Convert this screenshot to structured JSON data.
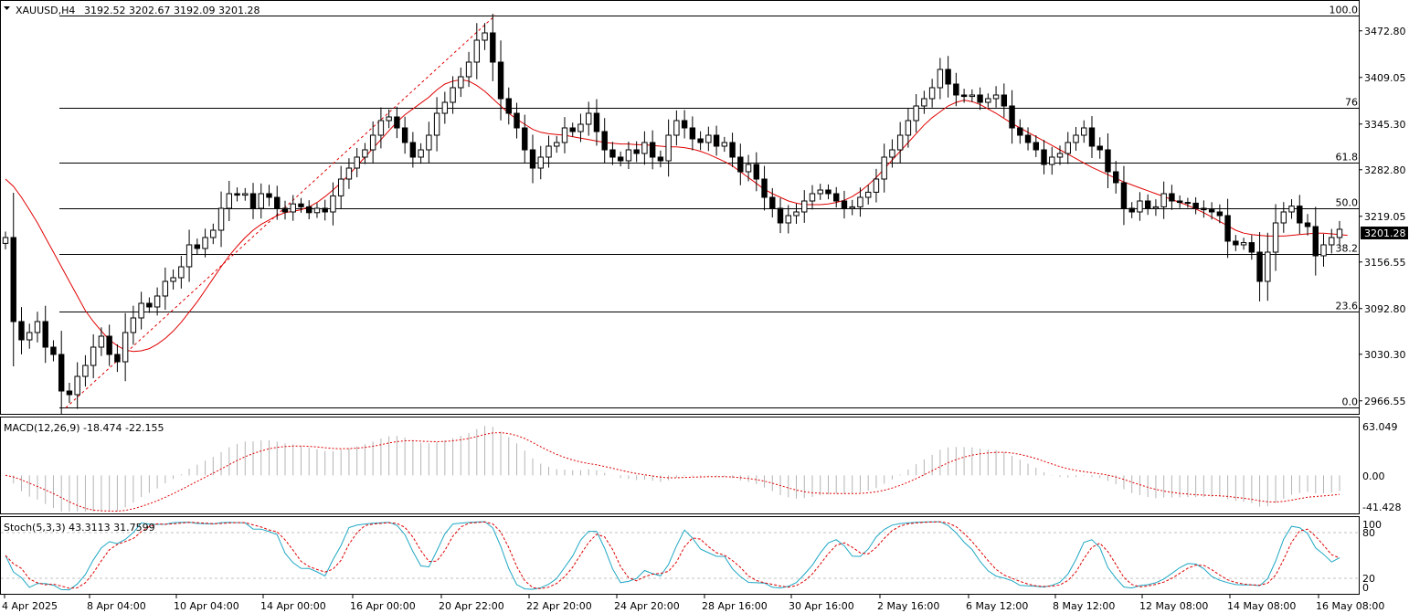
{
  "header": {
    "symbol": "XAUUSD,H4",
    "ohlc": "3192.52 3202.67 3192.09 3201.28"
  },
  "price_axis": {
    "ticks": [
      "3472.80",
      "3409.05",
      "3345.30",
      "3282.80",
      "3219.05",
      "3156.55",
      "3092.80",
      "3030.30",
      "2966.55"
    ],
    "current_price": "3201.28"
  },
  "fib_levels": [
    {
      "label": "100.0",
      "value": 3494
    },
    {
      "label": "76",
      "value": 3368
    },
    {
      "label": "61.8",
      "value": 3292
    },
    {
      "label": "50.0",
      "value": 3230
    },
    {
      "label": "38.2",
      "value": 3167
    },
    {
      "label": "23.6",
      "value": 3089
    },
    {
      "label": "0.0",
      "value": 2957
    }
  ],
  "time_axis": [
    "4 Apr 2025",
    "8 Apr 04:00",
    "10 Apr 04:00",
    "14 Apr 00:00",
    "16 Apr 00:00",
    "20 Apr 22:00",
    "22 Apr 20:00",
    "24 Apr 20:00",
    "28 Apr 16:00",
    "30 Apr 16:00",
    "2 May 16:00",
    "6 May 12:00",
    "8 May 12:00",
    "12 May 08:00",
    "14 May 08:00",
    "16 May 08:00"
  ],
  "macd": {
    "title": "MACD(12,26,9) -18.474 -22.155",
    "ticks": [
      "63.049",
      "0.00",
      "-41.428"
    ]
  },
  "stoch": {
    "title": "Stoch(5,3,3) 43.3113 31.7599",
    "ticks": [
      "100",
      "80",
      "20",
      "0"
    ]
  },
  "colors": {
    "bull": "#ffffff",
    "bear": "#000000",
    "ma": "#e00000",
    "signal": "#e00000",
    "stoch_main": "#1ea7c4",
    "hist": "#b4b4b4",
    "fib": "#000000",
    "current_bg": "#000000"
  },
  "chart_data": {
    "type": "candlestick",
    "closes": [
      3190,
      3075,
      3050,
      3060,
      3075,
      3040,
      3030,
      2980,
      2975,
      3000,
      3015,
      3040,
      3055,
      3030,
      3020,
      3060,
      3080,
      3100,
      3095,
      3110,
      3130,
      3135,
      3150,
      3180,
      3175,
      3190,
      3200,
      3230,
      3250,
      3248,
      3250,
      3230,
      3250,
      3245,
      3230,
      3225,
      3236,
      3232,
      3224,
      3230,
      3225,
      3247,
      3270,
      3285,
      3300,
      3310,
      3330,
      3350,
      3355,
      3340,
      3320,
      3300,
      3310,
      3330,
      3360,
      3375,
      3395,
      3410,
      3430,
      3460,
      3470,
      3430,
      3380,
      3360,
      3340,
      3310,
      3285,
      3300,
      3315,
      3320,
      3340,
      3335,
      3345,
      3360,
      3335,
      3310,
      3300,
      3295,
      3310,
      3305,
      3320,
      3300,
      3295,
      3330,
      3350,
      3340,
      3325,
      3320,
      3330,
      3315,
      3320,
      3300,
      3280,
      3290,
      3270,
      3245,
      3230,
      3210,
      3220,
      3225,
      3240,
      3250,
      3255,
      3250,
      3240,
      3230,
      3232,
      3245,
      3252,
      3270,
      3300,
      3310,
      3330,
      3350,
      3370,
      3380,
      3395,
      3420,
      3400,
      3385,
      3383,
      3385,
      3375,
      3380,
      3385,
      3370,
      3340,
      3330,
      3320,
      3310,
      3290,
      3300,
      3305,
      3320,
      3330,
      3340,
      3315,
      3310,
      3280,
      3265,
      3230,
      3225,
      3240,
      3230,
      3232,
      3250,
      3240,
      3238,
      3237,
      3230,
      3228,
      3225,
      3220,
      3185,
      3180,
      3183,
      3170,
      3130,
      3170,
      3210,
      3225,
      3233,
      3210,
      3205,
      3165,
      3180,
      3190,
      3201.28
    ],
    "ma20": [
      3270,
      3260,
      3245,
      3228,
      3210,
      3190,
      3170,
      3150,
      3130,
      3110,
      3090,
      3075,
      3062,
      3050,
      3042,
      3036,
      3034,
      3035,
      3038,
      3044,
      3052,
      3062,
      3074,
      3088,
      3102,
      3118,
      3134,
      3150,
      3165,
      3178,
      3190,
      3200,
      3208,
      3214,
      3220,
      3224,
      3226,
      3228,
      3232,
      3238,
      3246,
      3255,
      3265,
      3276,
      3288,
      3300,
      3312,
      3324,
      3336,
      3348,
      3358,
      3366,
      3374,
      3382,
      3392,
      3400,
      3404,
      3406,
      3404,
      3398,
      3390,
      3380,
      3370,
      3360,
      3352,
      3345,
      3338,
      3334,
      3332,
      3331,
      3330,
      3328,
      3326,
      3324,
      3322,
      3320,
      3319,
      3318,
      3318,
      3317,
      3317,
      3316,
      3315,
      3314,
      3314,
      3313,
      3311,
      3308,
      3304,
      3299,
      3294,
      3288,
      3280,
      3272,
      3264,
      3256,
      3250,
      3245,
      3240,
      3237,
      3235,
      3235,
      3235,
      3236,
      3238,
      3241,
      3246,
      3253,
      3262,
      3272,
      3284,
      3296,
      3308,
      3320,
      3332,
      3344,
      3354,
      3362,
      3370,
      3375,
      3378,
      3376,
      3372,
      3366,
      3360,
      3353,
      3346,
      3340,
      3334,
      3328,
      3322,
      3316,
      3310,
      3304,
      3298,
      3292,
      3286,
      3281,
      3276,
      3271,
      3266,
      3262,
      3258,
      3254,
      3250,
      3246,
      3242,
      3238,
      3234,
      3229,
      3224,
      3218,
      3212,
      3206,
      3200,
      3196,
      3194,
      3193,
      3192,
      3192,
      3192,
      3193,
      3194,
      3195,
      3196,
      3196,
      3195,
      3194,
      3193
    ],
    "price_range": [
      2950,
      3510
    ],
    "x_labels": [
      "4 Apr 2025",
      "8 Apr 04:00",
      "10 Apr 04:00",
      "14 Apr 00:00",
      "16 Apr 00:00",
      "20 Apr 22:00",
      "22 Apr 20:00",
      "24 Apr 20:00",
      "28 Apr 16:00",
      "30 Apr 16:00",
      "2 May 16:00",
      "6 May 12:00",
      "8 May 12:00",
      "12 May 08:00",
      "14 May 08:00",
      "16 May 08:00"
    ],
    "macd_range": [
      -41.428,
      63.049
    ],
    "stoch_range": [
      0,
      100
    ],
    "stoch_levels": [
      80,
      20
    ]
  }
}
